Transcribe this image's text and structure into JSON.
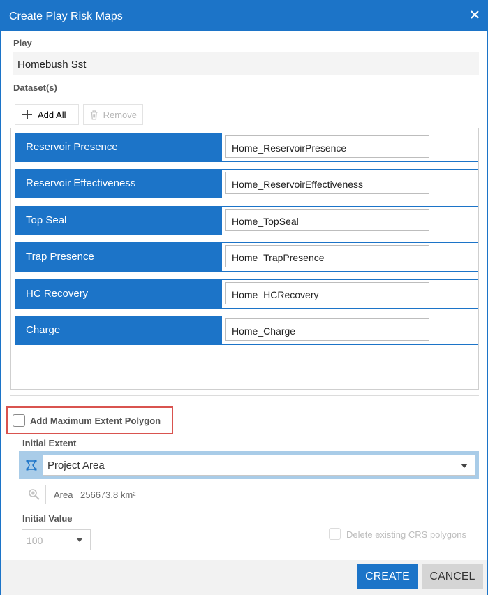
{
  "dialog": {
    "title": "Create Play Risk Maps"
  },
  "play": {
    "label": "Play",
    "value": "Homebush Sst"
  },
  "datasets": {
    "label": "Dataset(s)",
    "add_all_label": "Add All",
    "remove_label": "Remove",
    "items": [
      {
        "label": "Reservoir Presence",
        "value": "Home_ReservoirPresence"
      },
      {
        "label": "Reservoir Effectiveness",
        "value": "Home_ReservoirEffectiveness"
      },
      {
        "label": "Top Seal",
        "value": "Home_TopSeal"
      },
      {
        "label": "Trap Presence",
        "value": "Home_TrapPresence"
      },
      {
        "label": "HC Recovery",
        "value": "Home_HCRecovery"
      },
      {
        "label": "Charge",
        "value": "Home_Charge"
      }
    ]
  },
  "max_extent": {
    "label": "Add Maximum Extent Polygon",
    "checked": false
  },
  "initial_extent": {
    "label": "Initial Extent",
    "value": "Project Area",
    "area_label": "Area",
    "area_value": "256673.8 km²"
  },
  "initial_value": {
    "label": "Initial Value",
    "value": "100"
  },
  "delete_crs": {
    "label": "Delete existing CRS polygons"
  },
  "footer": {
    "create_label": "CREATE",
    "cancel_label": "CANCEL"
  },
  "colors": {
    "accent": "#1c74c8",
    "highlight_border": "#d9534f"
  }
}
